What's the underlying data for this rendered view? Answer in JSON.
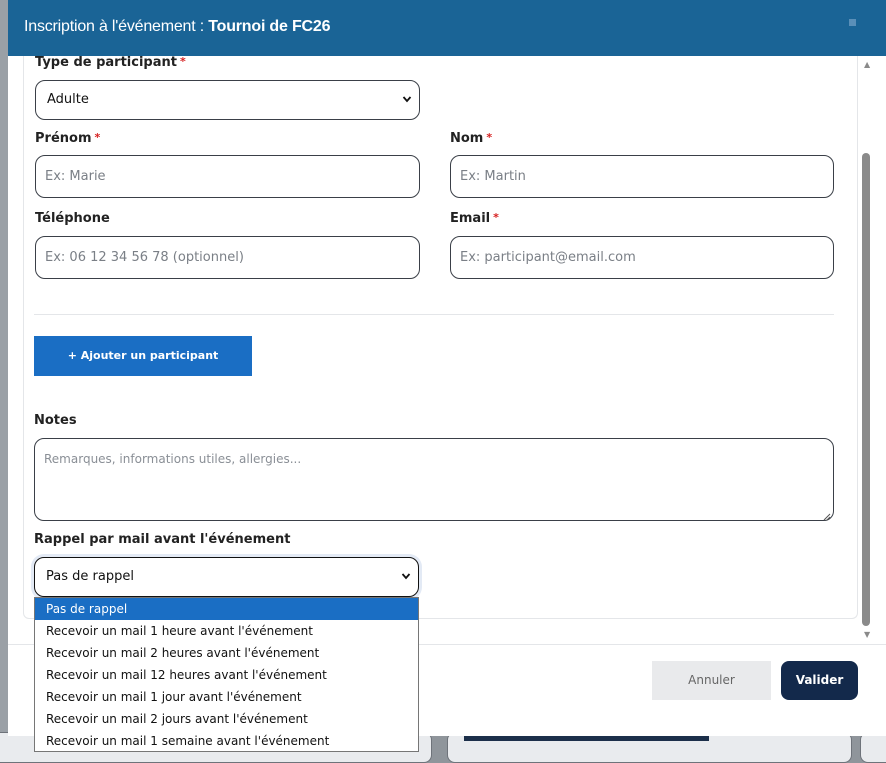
{
  "header": {
    "title_prefix": "Inscription à l'événement : ",
    "title_event": "Tournoi de FC26"
  },
  "form": {
    "participant_type": {
      "label": "Type de participant",
      "required_mark": "*",
      "value": "Adulte"
    },
    "first_name": {
      "label": "Prénom",
      "required_mark": "*",
      "placeholder": "Ex: Marie"
    },
    "last_name": {
      "label": "Nom",
      "required_mark": "*",
      "placeholder": "Ex: Martin"
    },
    "phone": {
      "label": "Téléphone",
      "placeholder": "Ex: 06 12 34 56 78 (optionnel)"
    },
    "email": {
      "label": "Email",
      "required_mark": "*",
      "placeholder": "Ex: participant@email.com"
    },
    "add_participant_label": "+ Ajouter un participant",
    "notes": {
      "label": "Notes",
      "placeholder": "Remarques, informations utiles, allergies..."
    },
    "reminder": {
      "label": "Rappel par mail avant l'événement",
      "value": "Pas de rappel",
      "options": [
        "Pas de rappel",
        "Recevoir un mail 1 heure avant l'événement",
        "Recevoir un mail 2 heures avant l'événement",
        "Recevoir un mail 12 heures avant l'événement",
        "Recevoir un mail 1 jour avant l'événement",
        "Recevoir un mail 2 jours avant l'événement",
        "Recevoir un mail 1 semaine avant l'événement"
      ],
      "selected_index": 0
    }
  },
  "footer": {
    "cancel_label": "Annuler",
    "validate_label": "Valider"
  },
  "colors": {
    "header_bg": "#1a6496",
    "primary_button": "#1a6ec4",
    "validate_button": "#13294b",
    "required": "#d61f1f"
  },
  "icons": {
    "select_chevron": "chevron-down-icon",
    "scroll_up": "triangle-up-icon",
    "scroll_down": "triangle-down-icon"
  }
}
